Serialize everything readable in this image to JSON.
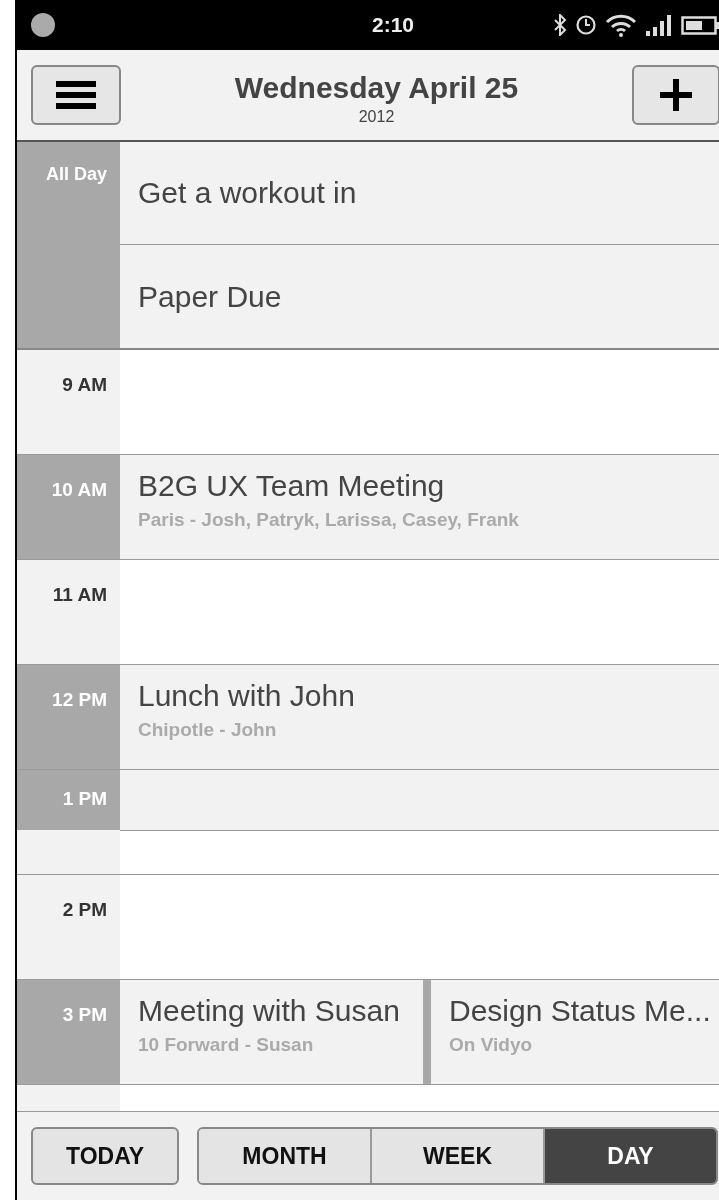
{
  "status_bar": {
    "time": "2:10"
  },
  "header": {
    "title": "Wednesday April 25",
    "year": "2012"
  },
  "all_day": {
    "label": "All Day",
    "events": [
      {
        "title": "Get a workout in"
      },
      {
        "title": "Paper Due"
      }
    ]
  },
  "slots": [
    {
      "label": "9 AM",
      "kind": "empty"
    },
    {
      "label": "10 AM",
      "kind": "events",
      "events": [
        {
          "title": "B2G UX Team Meeting",
          "detail": "Paris - Josh, Patryk, Larissa, Casey, Frank"
        }
      ]
    },
    {
      "label": "11 AM",
      "kind": "empty"
    },
    {
      "label": "12 PM",
      "kind": "events",
      "events": [
        {
          "title": "Lunch with John",
          "detail": "Chipotle - John"
        }
      ]
    },
    {
      "label": "1 PM",
      "kind": "block"
    },
    {
      "label": "2 PM",
      "kind": "empty"
    },
    {
      "label": "3 PM",
      "kind": "events",
      "events": [
        {
          "title": "Meeting with Susan",
          "detail": "10 Forward - Susan"
        },
        {
          "title": "Design Status Me...",
          "detail": "On Vidyo"
        }
      ]
    }
  ],
  "footer": {
    "today": "TODAY",
    "views": [
      {
        "label": "MONTH",
        "selected": false
      },
      {
        "label": "WEEK",
        "selected": false
      },
      {
        "label": "DAY",
        "selected": true
      }
    ]
  }
}
